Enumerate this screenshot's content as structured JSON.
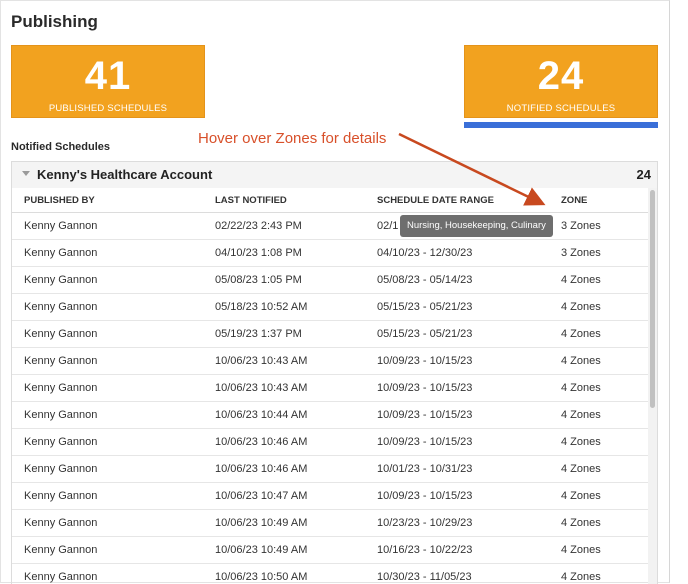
{
  "page": {
    "title": "Publishing"
  },
  "stats": {
    "published": {
      "value": "41",
      "label": "PUBLISHED SCHEDULES"
    },
    "notified": {
      "value": "24",
      "label": "NOTIFIED SCHEDULES"
    }
  },
  "annotation": {
    "text": "Hover over Zones for details",
    "color": "#d8502a"
  },
  "section": {
    "label": "Notified Schedules"
  },
  "account": {
    "name": "Kenny's Healthcare Account",
    "count": "24"
  },
  "table": {
    "headers": [
      "PUBLISHED BY",
      "LAST NOTIFIED",
      "SCHEDULE DATE RANGE",
      "ZONE"
    ],
    "rows": [
      {
        "published_by": "Kenny Gannon",
        "last_notified": "02/22/23 2:43 PM",
        "date_range": "02/1",
        "zone": "3 Zones"
      },
      {
        "published_by": "Kenny Gannon",
        "last_notified": "04/10/23 1:08 PM",
        "date_range": "04/10/23 - 12/30/23",
        "zone": "3 Zones"
      },
      {
        "published_by": "Kenny Gannon",
        "last_notified": "05/08/23 1:05 PM",
        "date_range": "05/08/23 - 05/14/23",
        "zone": "4 Zones"
      },
      {
        "published_by": "Kenny Gannon",
        "last_notified": "05/18/23 10:52 AM",
        "date_range": "05/15/23 - 05/21/23",
        "zone": "4 Zones"
      },
      {
        "published_by": "Kenny Gannon",
        "last_notified": "05/19/23 1:37 PM",
        "date_range": "05/15/23 - 05/21/23",
        "zone": "4 Zones"
      },
      {
        "published_by": "Kenny Gannon",
        "last_notified": "10/06/23 10:43 AM",
        "date_range": "10/09/23 - 10/15/23",
        "zone": "4 Zones"
      },
      {
        "published_by": "Kenny Gannon",
        "last_notified": "10/06/23 10:43 AM",
        "date_range": "10/09/23 - 10/15/23",
        "zone": "4 Zones"
      },
      {
        "published_by": "Kenny Gannon",
        "last_notified": "10/06/23 10:44 AM",
        "date_range": "10/09/23 - 10/15/23",
        "zone": "4 Zones"
      },
      {
        "published_by": "Kenny Gannon",
        "last_notified": "10/06/23 10:46 AM",
        "date_range": "10/09/23 - 10/15/23",
        "zone": "4 Zones"
      },
      {
        "published_by": "Kenny Gannon",
        "last_notified": "10/06/23 10:46 AM",
        "date_range": "10/01/23 - 10/31/23",
        "zone": "4 Zones"
      },
      {
        "published_by": "Kenny Gannon",
        "last_notified": "10/06/23 10:47 AM",
        "date_range": "10/09/23 - 10/15/23",
        "zone": "4 Zones"
      },
      {
        "published_by": "Kenny Gannon",
        "last_notified": "10/06/23 10:49 AM",
        "date_range": "10/23/23 - 10/29/23",
        "zone": "4 Zones"
      },
      {
        "published_by": "Kenny Gannon",
        "last_notified": "10/06/23 10:49 AM",
        "date_range": "10/16/23 - 10/22/23",
        "zone": "4 Zones"
      },
      {
        "published_by": "Kenny Gannon",
        "last_notified": "10/06/23 10:50 AM",
        "date_range": "10/30/23 - 11/05/23",
        "zone": "4 Zones"
      }
    ]
  },
  "tooltip": {
    "text": "Nursing, Housekeeping, Culinary"
  },
  "colors": {
    "card": "#f2a21f",
    "underline": "#3a6fd8",
    "tooltip": "#6e6e6e"
  }
}
